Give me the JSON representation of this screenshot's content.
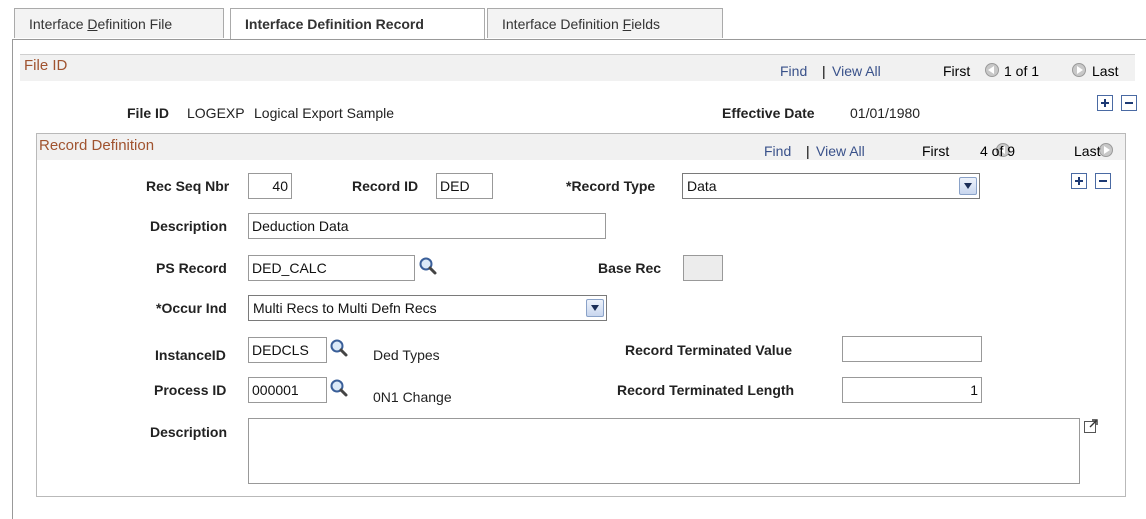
{
  "tabs": [
    {
      "label_pre": "Interface ",
      "label_ul": "D",
      "label_post": "efinition File"
    },
    {
      "label": "Interface Definition Record"
    },
    {
      "label_pre": "Interface Definition ",
      "label_ul": "F",
      "label_post": "ields"
    }
  ],
  "file_section": {
    "title": "File ID",
    "find": "Find",
    "sep": "|",
    "view_all": "View All",
    "first": "First",
    "position": "1 of 1",
    "last": "Last",
    "file_id_label": "File ID",
    "file_id_value": "LOGEXP",
    "file_id_desc": "Logical Export Sample",
    "eff_date_label": "Effective Date",
    "eff_date_value": "01/01/1980"
  },
  "record_section": {
    "title": "Record Definition",
    "find": "Find",
    "sep": "|",
    "view_all": "View All",
    "first": "First",
    "position": "4 of 9",
    "last": "Last",
    "rec_seq_label": "Rec Seq Nbr",
    "rec_seq_value": "40",
    "record_id_label": "Record ID",
    "record_id_value": "DED",
    "record_type_label": "*Record Type",
    "record_type_value": "Data",
    "description_label": "Description",
    "description_value": "Deduction Data",
    "ps_record_label": "PS Record",
    "ps_record_value": "DED_CALC",
    "base_rec_label": "Base Rec",
    "occur_ind_label": "*Occur Ind",
    "occur_ind_value": "Multi Recs to Multi Defn Recs",
    "instance_id_label": "InstanceID",
    "instance_id_value": "DEDCLS",
    "instance_id_desc": "Ded Types",
    "rec_term_value_label": "Record Terminated Value",
    "rec_term_value_value": "",
    "process_id_label": "Process ID",
    "process_id_value": "000001",
    "process_id_desc": "0N1 Change",
    "rec_term_length_label": "Record Terminated Length",
    "rec_term_length_value": "1",
    "long_desc_label": "Description",
    "long_desc_value": ""
  },
  "icons": {
    "prev": "prev-circle-icon",
    "next": "next-circle-icon",
    "add": "add-row-icon",
    "delete": "delete-row-icon",
    "lookup": "magnifier-lookup-icon",
    "expand": "expand-textarea-icon"
  }
}
